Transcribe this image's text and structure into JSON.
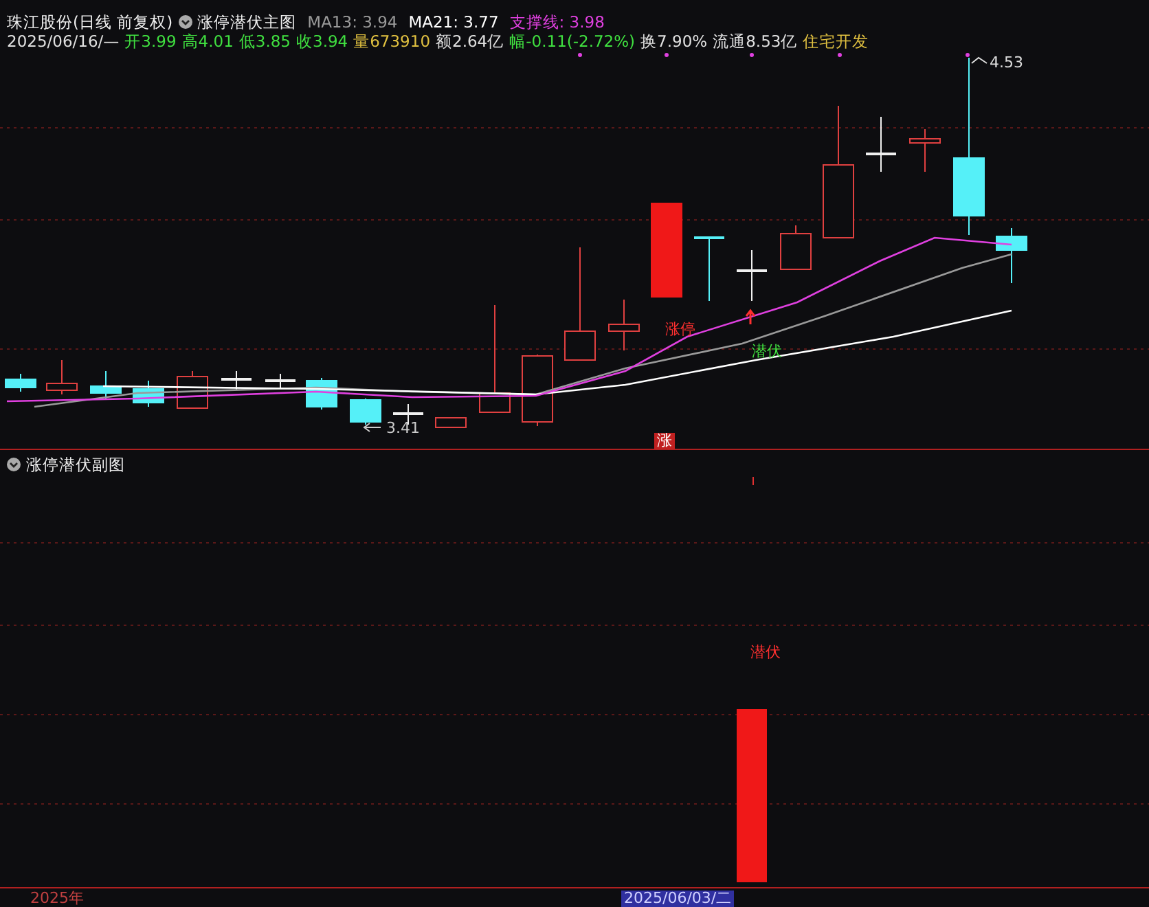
{
  "main_chart": {
    "stock": "珠江股份(日线 前复权)",
    "indicator": "涨停潜伏主图",
    "lines": [
      {
        "label": "MA13: 3.94",
        "color": "#9a9a9a"
      },
      {
        "label": "MA21: 3.77",
        "color": "#ffffff"
      },
      {
        "label": "支撑线: 3.98",
        "color": "#e040e0"
      }
    ],
    "quote": [
      {
        "text": "2025/06/16/—",
        "color": "#e0e0e0"
      },
      {
        "text": "开3.99",
        "color": "#40e040"
      },
      {
        "text": "高4.01",
        "color": "#40e040"
      },
      {
        "text": "低3.85",
        "color": "#40e040"
      },
      {
        "text": "收3.94",
        "color": "#40e040"
      },
      {
        "text": "量673910",
        "color": "#e0c040"
      },
      {
        "text": "额2.64亿",
        "color": "#e0e0e0"
      },
      {
        "text": "幅-0.11(-2.72%)",
        "color": "#40e040"
      },
      {
        "text": "换7.90%",
        "color": "#e0e0e0"
      },
      {
        "text": "流通8.53亿",
        "color": "#e0e0e0"
      },
      {
        "text": "住宅开发",
        "color": "#e0c040"
      }
    ],
    "high_label": "4.53",
    "low_label": "3.41",
    "limit_up_label": "涨停",
    "lurk_label": "潜伏",
    "limit_mark": "涨"
  },
  "sub_chart": {
    "title": "涨停潜伏副图",
    "signal_label": "潜伏"
  },
  "time_axis": [
    {
      "text": "2025年",
      "selected": false
    },
    {
      "text": "2025/06/03/二",
      "selected": true
    }
  ]
}
